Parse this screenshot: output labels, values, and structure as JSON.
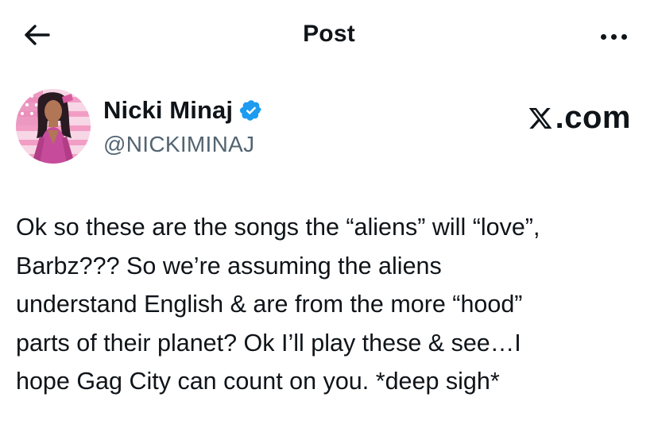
{
  "header": {
    "title": "Post",
    "back_icon": "arrow-left-icon",
    "more_icon": "more-horizontal-icon"
  },
  "post": {
    "author_name": "Nicki Minaj",
    "author_handle": "@NICKIMINAJ",
    "verified_icon": "verified-badge-icon",
    "verified_color": "#1d9bf0",
    "source_label": ".com",
    "source_logo": "x-logo-icon",
    "lines": [
      "Ok so these are the songs the “aliens” will “love”,",
      "Barbz??? So we’re assuming the aliens",
      "understand English & are from the more “hood”",
      "parts of their planet? Ok I’ll play these & see…I",
      "hope Gag City can count on you. *deep sigh*"
    ]
  },
  "colors": {
    "text_primary": "#0f1419",
    "text_secondary": "#536471",
    "background": "#ffffff"
  }
}
